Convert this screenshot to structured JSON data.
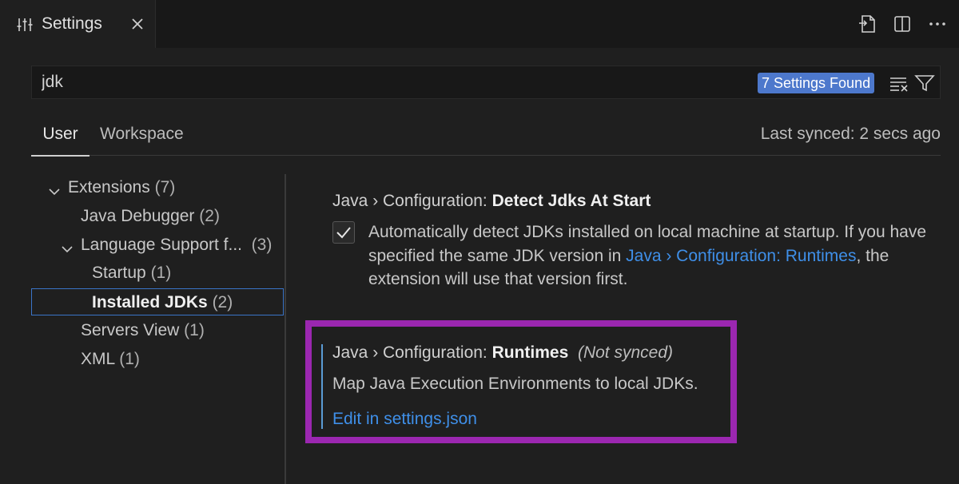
{
  "tab": {
    "title": "Settings"
  },
  "search": {
    "value": "jdk",
    "badge": "7 Settings Found"
  },
  "scope": {
    "user": "User",
    "workspace": "Workspace",
    "last_synced": "Last synced: 2 secs ago"
  },
  "tree": {
    "extensions": {
      "label": "Extensions",
      "count": "(7)"
    },
    "java_debugger": {
      "label": "Java Debugger",
      "count": "(2)"
    },
    "language_support": {
      "label": "Language Support f...",
      "count": "(3)"
    },
    "startup": {
      "label": "Startup",
      "count": "(1)"
    },
    "installed_jdks": {
      "label": "Installed JDKs",
      "count": "(2)"
    },
    "servers_view": {
      "label": "Servers View",
      "count": "(1)"
    },
    "xml": {
      "label": "XML",
      "count": "(1)"
    }
  },
  "settings": {
    "detect": {
      "category": "Java › Configuration: ",
      "name": "Detect Jdks At Start",
      "checked": true,
      "desc_part1": "Automatically detect JDKs installed on local machine at startup. If you have specified the same JDK version in ",
      "desc_link": "Java › Configuration: Runtimes",
      "desc_part2": ", the extension will use that version first."
    },
    "runtimes": {
      "category": "Java › Configuration: ",
      "name": "Runtimes",
      "sync_note": "(Not synced)",
      "description": "Map Java Execution Environments to local JDKs.",
      "edit_link": "Edit in settings.json"
    }
  },
  "colors": {
    "highlight": "#9b27b0",
    "link": "#3f8fe8",
    "badge": "#4d78cc"
  }
}
